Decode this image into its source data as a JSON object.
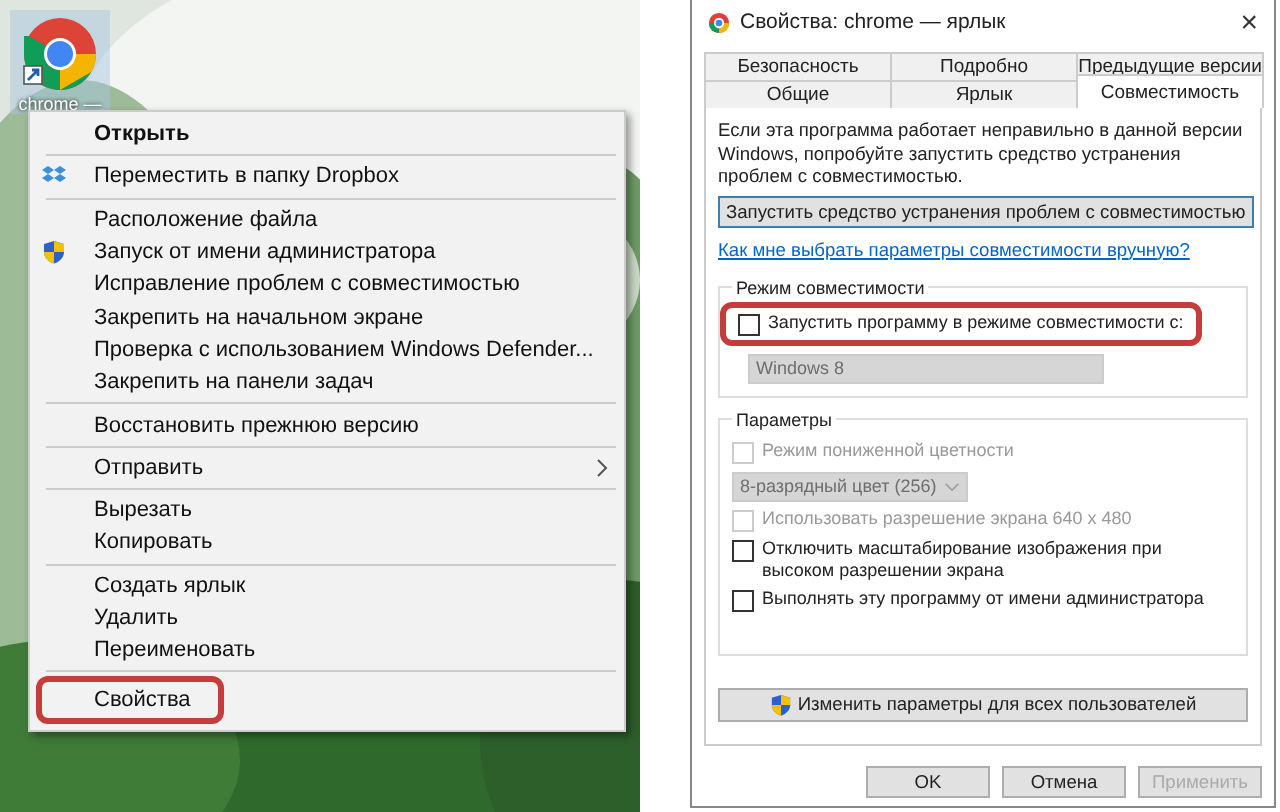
{
  "desktop": {
    "shortcut_label": "chrome —"
  },
  "context_menu": {
    "groups": [
      [
        {
          "kind": "plain",
          "label": "Открыть",
          "default": true,
          "submenu": false,
          "highlighted": false
        }
      ],
      [
        {
          "kind": "dropbox",
          "label": "Переместить в папку Dropbox",
          "default": false,
          "submenu": false,
          "highlighted": false
        }
      ],
      [
        {
          "kind": "plain",
          "label": "Расположение файла",
          "default": false,
          "submenu": false,
          "highlighted": false
        },
        {
          "kind": "shield",
          "label": "Запуск от имени администратора",
          "default": false,
          "submenu": false,
          "highlighted": false
        },
        {
          "kind": "plain",
          "label": "Исправление проблем с совместимостью",
          "default": false,
          "submenu": false,
          "highlighted": false
        },
        {
          "kind": "plain",
          "label": "Закрепить на начальном экране",
          "default": false,
          "submenu": false,
          "highlighted": false
        },
        {
          "kind": "plain",
          "label": "Проверка с использованием Windows Defender...",
          "default": false,
          "submenu": false,
          "highlighted": false
        },
        {
          "kind": "plain",
          "label": "Закрепить на панели задач",
          "default": false,
          "submenu": false,
          "highlighted": false
        }
      ],
      [
        {
          "kind": "plain",
          "label": "Восстановить прежнюю версию",
          "default": false,
          "submenu": false,
          "highlighted": false
        }
      ],
      [
        {
          "kind": "plain",
          "label": "Отправить",
          "default": false,
          "submenu": true,
          "highlighted": false
        }
      ],
      [
        {
          "kind": "plain",
          "label": "Вырезать",
          "default": false,
          "submenu": false,
          "highlighted": false
        },
        {
          "kind": "plain",
          "label": "Копировать",
          "default": false,
          "submenu": false,
          "highlighted": false
        }
      ],
      [
        {
          "kind": "plain",
          "label": "Создать ярлык",
          "default": false,
          "submenu": false,
          "highlighted": false
        },
        {
          "kind": "plain",
          "label": "Удалить",
          "default": false,
          "submenu": false,
          "highlighted": false
        },
        {
          "kind": "plain",
          "label": "Переименовать",
          "default": false,
          "submenu": false,
          "highlighted": false
        }
      ],
      [
        {
          "kind": "plain",
          "label": "Свойства",
          "default": false,
          "submenu": false,
          "highlighted": true
        }
      ]
    ]
  },
  "dialog": {
    "title": "Свойства: chrome — ярлык",
    "close": "×",
    "tab_rows": [
      [
        {
          "label": "Безопасность",
          "selected": false
        },
        {
          "label": "Подробно",
          "selected": false
        },
        {
          "label": "Предыдущие версии",
          "selected": false
        }
      ],
      [
        {
          "label": "Общие",
          "selected": false
        },
        {
          "label": "Ярлык",
          "selected": false
        },
        {
          "label": "Совместимость",
          "selected": true
        }
      ]
    ],
    "intro": "Если эта программа работает неправильно в данной версии Windows, попробуйте запустить средство устранения проблем с совместимостью.",
    "troubleshoot_button": "Запустить средство устранения проблем с совместимостью",
    "manual_link": "Как мне выбрать параметры совместимости вручную?",
    "compat_mode": {
      "title": "Режим совместимости",
      "highlighted": true,
      "checkbox": {
        "label": "Запустить программу в режиме совместимости с:",
        "checked": false,
        "disabled": false
      },
      "dropdown": {
        "value": "Windows 8",
        "disabled": true
      }
    },
    "settings": {
      "title": "Параметры",
      "items": [
        {
          "kind": "checkbox",
          "label": "Режим пониженной цветности",
          "checked": false,
          "disabled": true
        },
        {
          "kind": "dropdown",
          "value": "8-разрядный цвет (256)",
          "disabled": true
        },
        {
          "kind": "checkbox",
          "label": "Использовать разрешение экрана 640 x 480",
          "checked": false,
          "disabled": true
        },
        {
          "kind": "checkbox",
          "label": "Отключить масштабирование изображения при высоком разрешении экрана",
          "checked": false,
          "disabled": false
        },
        {
          "kind": "checkbox",
          "label": "Выполнять эту программу от имени администратора",
          "checked": false,
          "disabled": false
        }
      ]
    },
    "all_users_button": "Изменить параметры для всех пользователей",
    "buttons": [
      {
        "label": "OK",
        "disabled": false
      },
      {
        "label": "Отмена",
        "disabled": false
      },
      {
        "label": "Применить",
        "disabled": true
      }
    ]
  }
}
